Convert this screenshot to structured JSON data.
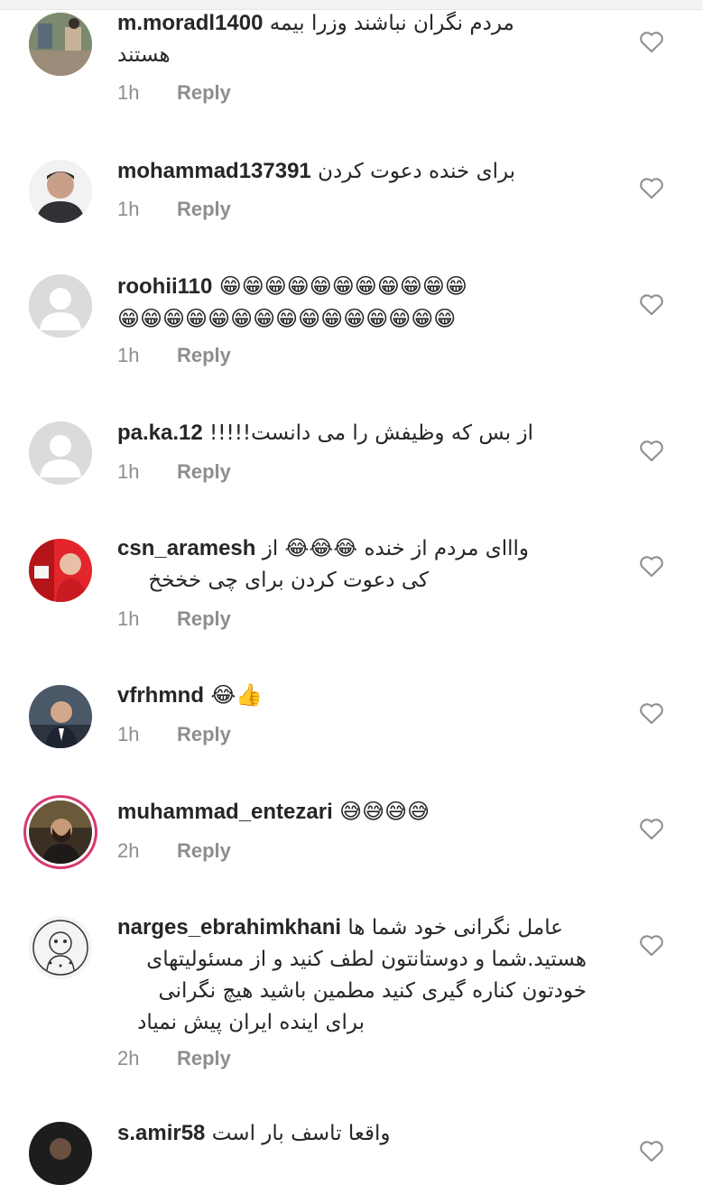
{
  "comments": [
    {
      "user": "m.moradl1400",
      "text_line1": "مردم نگران نباشند وزرا بیمه",
      "text_line2": "هستند",
      "time": "1h",
      "reply": "Reply",
      "avatar": "photo-people"
    },
    {
      "user": "mohammad137391",
      "text_line1": "برای خنده دعوت کردن",
      "time": "1h",
      "reply": "Reply",
      "avatar": "photo-man"
    },
    {
      "user": "roohii110",
      "emoji_line1": "😁😁😁😁😁😁😁😁😁😁😁",
      "emoji_line2": "😁😁😁😁😁😁😁😁😁😁😁😁😁😁😁",
      "time": "1h",
      "reply": "Reply",
      "avatar": "default"
    },
    {
      "user": "pa.ka.12",
      "text_line1": "!!!!!از بس که وظیفش را می دانست",
      "time": "1h",
      "reply": "Reply",
      "avatar": "default"
    },
    {
      "user": "csn_aramesh",
      "text_line1": "وااای مردم از خنده 😂😂😂 از",
      "text_line2": "کی دعوت کردن برای چی خخخخ",
      "time": "1h",
      "reply": "Reply",
      "avatar": "photo-red"
    },
    {
      "user": "vfrhmnd",
      "emoji_line1": "😂👍",
      "time": "1h",
      "reply": "Reply",
      "avatar": "photo-suit"
    },
    {
      "user": "muhammad_entezari",
      "emoji_line1": "😅😅😅😅",
      "time": "2h",
      "reply": "Reply",
      "avatar": "photo-story"
    },
    {
      "user": "narges_ebrahimkhani",
      "text_line1": "عامل نگرانی خود شما ها",
      "text_line2": "هستید.شما و دوستانتون لطف کنید و از مسئولیتهای",
      "text_line3": "خودتون کناره گیری کنید مطمین باشید هیچ نگرانی",
      "text_line4": "برای اینده ایران پیش نمیاد",
      "time": "2h",
      "reply": "Reply",
      "avatar": "drawing"
    },
    {
      "user": "s.amir58",
      "text_line1": "واقعا تاسف بار است",
      "avatar": "photo-dark"
    }
  ],
  "colors": {
    "username": "#262626",
    "meta": "#8e8e8e",
    "story_ring": "#d7376f",
    "avatar_default": "#d9d9d9"
  },
  "icons": {
    "like": "heart-outline-icon"
  }
}
